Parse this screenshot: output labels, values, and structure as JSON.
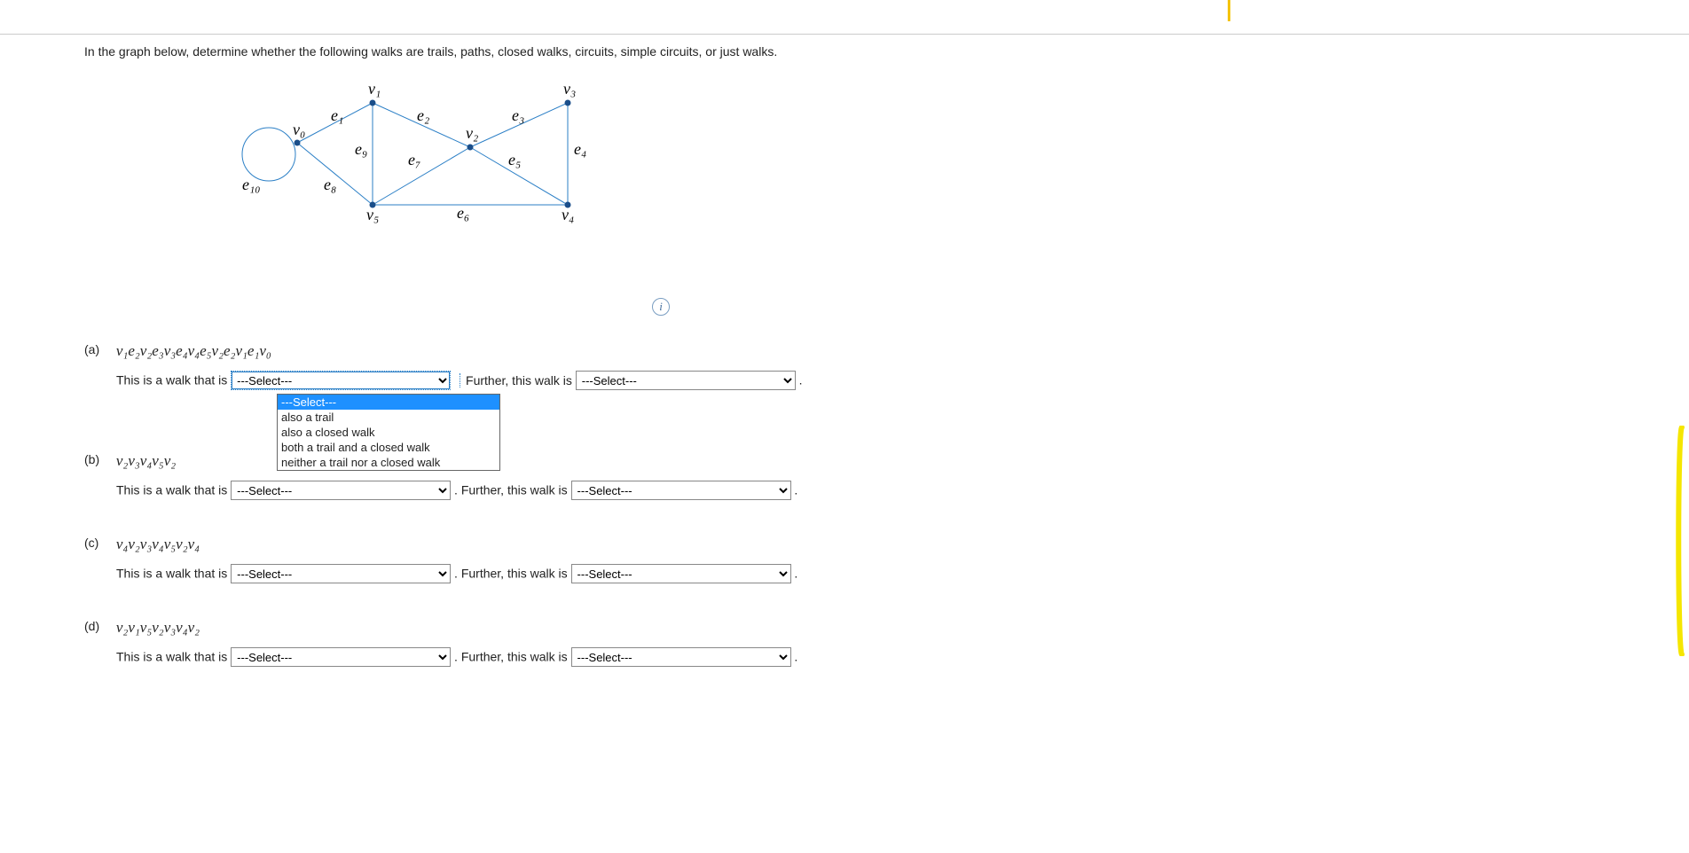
{
  "prompt": "In the graph below, determine whether the following walks are trails, paths, closed walks, circuits, simple circuits, or just walks.",
  "graph": {
    "vertices": {
      "v0": "v₀",
      "v1": "v₁",
      "v2": "v₂",
      "v3": "v₃",
      "v4": "v₄",
      "v5": "v₅"
    },
    "edges": {
      "e1": "e₁",
      "e2": "e₂",
      "e3": "e₃",
      "e4": "e₄",
      "e5": "e₅",
      "e6": "e₆",
      "e7": "e₇",
      "e8": "e₈",
      "e9": "e₉",
      "e10": "e₁₀"
    }
  },
  "info_icon_label": "i",
  "select_placeholder": "---Select---",
  "select_options": [
    "---Select---",
    "also a trail",
    "also a closed walk",
    "both a trail and a closed walk",
    "neither a trail nor a closed walk"
  ],
  "questions": {
    "a": {
      "label": "(a)",
      "expr": "v₁e₂v₂e₃v₃e₄v₄e₅v₂e₂v₁e₁v₀",
      "line_pre": "This is a walk that is",
      "line_mid_dotted": "Further, this walk is",
      "line_end": "."
    },
    "b": {
      "label": "(b)",
      "expr": "v₂v₃v₄v₅v₂",
      "line_pre": "This is a walk that is",
      "line_mid": ". Further, this walk is",
      "line_end": "."
    },
    "c": {
      "label": "(c)",
      "expr": "v₄v₂v₃v₄v₅v₂v₄",
      "line_pre": "This is a walk that is",
      "line_mid": ". Further, this walk is",
      "line_end": "."
    },
    "d": {
      "label": "(d)",
      "expr": "v₂v₁v₅v₂v₃v₄v₂",
      "line_pre": "This is a walk that is",
      "line_mid": ". Further, this walk is",
      "line_end": "."
    }
  }
}
